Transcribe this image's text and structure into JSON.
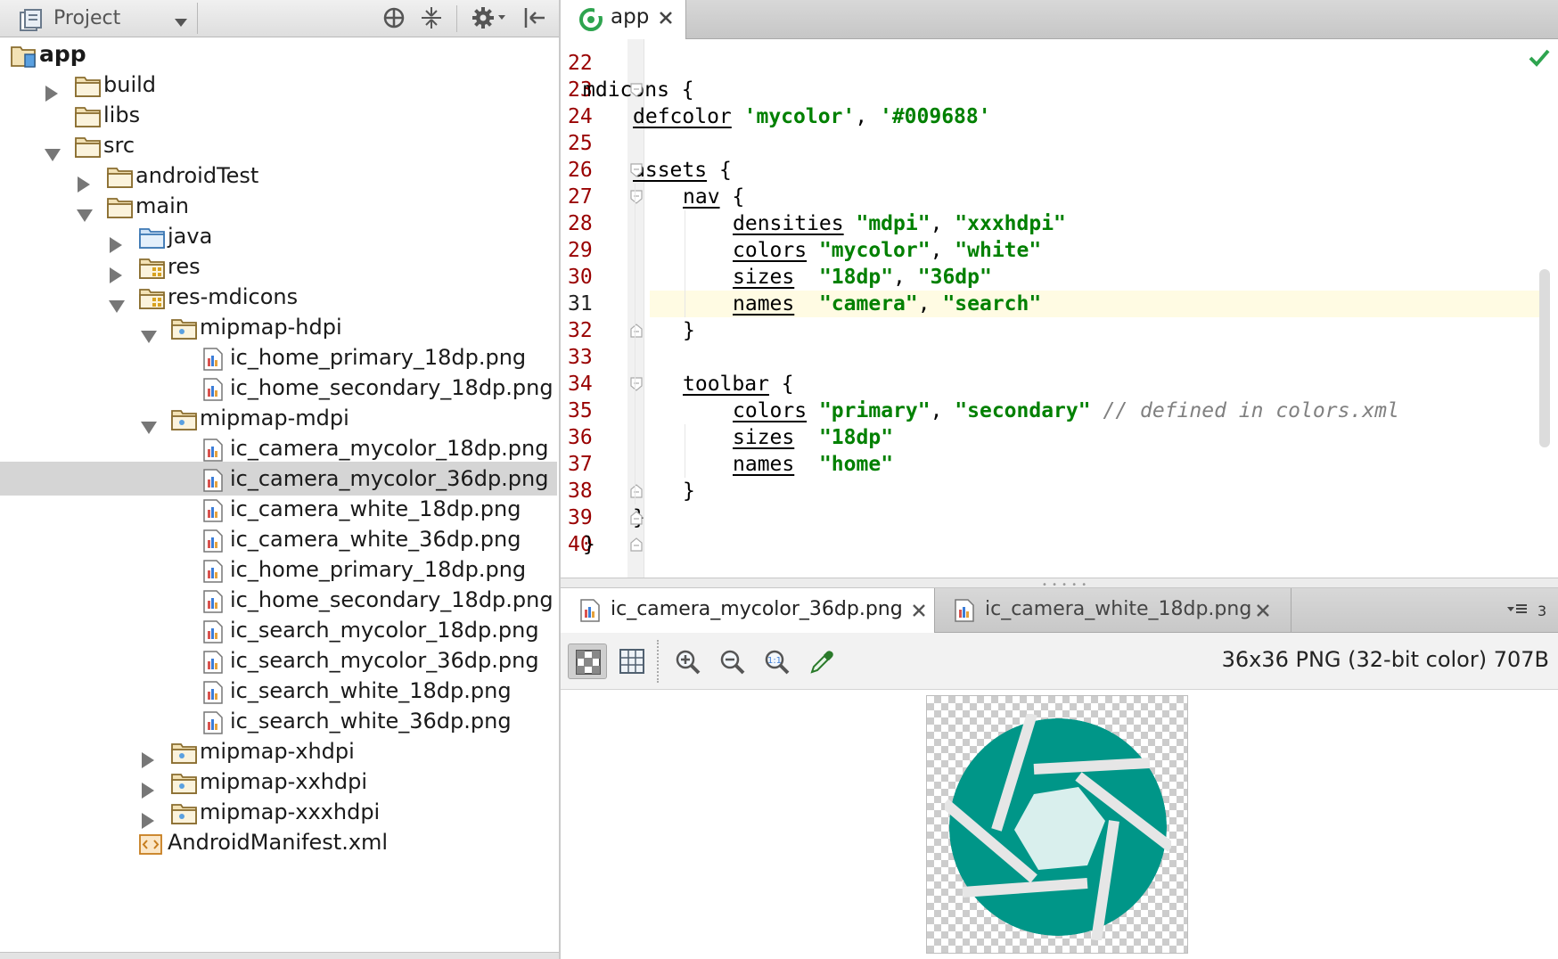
{
  "colors": {
    "accent_teal": "#009688",
    "string_green": "#008000",
    "line_number_red": "#990000",
    "comment_gray": "#808080"
  },
  "project_panel": {
    "title": "Project",
    "toolbar_icons": [
      "crosshair-icon",
      "collapse-icon",
      "gear-icon",
      "hide-panel-icon"
    ],
    "tree": [
      {
        "label": "app",
        "depth": 0,
        "expanded": null,
        "icon": "module-folder-icon",
        "bold": true
      },
      {
        "label": "build",
        "depth": 1,
        "expanded": false,
        "icon": "folder-icon"
      },
      {
        "label": "libs",
        "depth": 1,
        "expanded": null,
        "icon": "folder-icon"
      },
      {
        "label": "src",
        "depth": 1,
        "expanded": true,
        "icon": "folder-icon"
      },
      {
        "label": "androidTest",
        "depth": 2,
        "expanded": false,
        "icon": "folder-icon"
      },
      {
        "label": "main",
        "depth": 2,
        "expanded": true,
        "icon": "folder-icon"
      },
      {
        "label": "java",
        "depth": 3,
        "expanded": false,
        "icon": "source-folder-icon"
      },
      {
        "label": "res",
        "depth": 3,
        "expanded": false,
        "icon": "resource-folder-icon"
      },
      {
        "label": "res-mdicons",
        "depth": 3,
        "expanded": true,
        "icon": "resource-folder-icon"
      },
      {
        "label": "mipmap-hdpi",
        "depth": 4,
        "expanded": true,
        "icon": "package-folder-icon"
      },
      {
        "label": "ic_home_primary_18dp.png",
        "depth": 5,
        "expanded": null,
        "icon": "image-file-icon"
      },
      {
        "label": "ic_home_secondary_18dp.png",
        "depth": 5,
        "expanded": null,
        "icon": "image-file-icon"
      },
      {
        "label": "mipmap-mdpi",
        "depth": 4,
        "expanded": true,
        "icon": "package-folder-icon"
      },
      {
        "label": "ic_camera_mycolor_18dp.png",
        "depth": 5,
        "expanded": null,
        "icon": "image-file-icon"
      },
      {
        "label": "ic_camera_mycolor_36dp.png",
        "depth": 5,
        "expanded": null,
        "icon": "image-file-icon",
        "selected": true
      },
      {
        "label": "ic_camera_white_18dp.png",
        "depth": 5,
        "expanded": null,
        "icon": "image-file-icon"
      },
      {
        "label": "ic_camera_white_36dp.png",
        "depth": 5,
        "expanded": null,
        "icon": "image-file-icon"
      },
      {
        "label": "ic_home_primary_18dp.png",
        "depth": 5,
        "expanded": null,
        "icon": "image-file-icon"
      },
      {
        "label": "ic_home_secondary_18dp.png",
        "depth": 5,
        "expanded": null,
        "icon": "image-file-icon"
      },
      {
        "label": "ic_search_mycolor_18dp.png",
        "depth": 5,
        "expanded": null,
        "icon": "image-file-icon"
      },
      {
        "label": "ic_search_mycolor_36dp.png",
        "depth": 5,
        "expanded": null,
        "icon": "image-file-icon"
      },
      {
        "label": "ic_search_white_18dp.png",
        "depth": 5,
        "expanded": null,
        "icon": "image-file-icon"
      },
      {
        "label": "ic_search_white_36dp.png",
        "depth": 5,
        "expanded": null,
        "icon": "image-file-icon"
      },
      {
        "label": "mipmap-xhdpi",
        "depth": 4,
        "expanded": false,
        "icon": "package-folder-icon"
      },
      {
        "label": "mipmap-xxhdpi",
        "depth": 4,
        "expanded": false,
        "icon": "package-folder-icon"
      },
      {
        "label": "mipmap-xxxhdpi",
        "depth": 4,
        "expanded": false,
        "icon": "package-folder-icon"
      },
      {
        "label": "AndroidManifest.xml",
        "depth": 3,
        "expanded": null,
        "icon": "xml-file-icon"
      }
    ]
  },
  "editor": {
    "tab_label": "app",
    "current_line": "31",
    "lines": [
      {
        "num": "22",
        "indent": 0,
        "tokens": []
      },
      {
        "num": "23",
        "indent": 0,
        "tokens": [
          {
            "t": "plain",
            "v": "mdicons {"
          }
        ]
      },
      {
        "num": "24",
        "indent": 1,
        "tokens": [
          {
            "t": "kw",
            "v": "defcolor"
          },
          {
            "t": "plain",
            "v": " "
          },
          {
            "t": "str",
            "v": "'mycolor'"
          },
          {
            "t": "plain",
            "v": ", "
          },
          {
            "t": "str",
            "v": "'#009688'"
          }
        ]
      },
      {
        "num": "25",
        "indent": 0,
        "tokens": []
      },
      {
        "num": "26",
        "indent": 1,
        "tokens": [
          {
            "t": "kw",
            "v": "assets"
          },
          {
            "t": "plain",
            "v": " {"
          }
        ]
      },
      {
        "num": "27",
        "indent": 2,
        "tokens": [
          {
            "t": "kw",
            "v": "nav"
          },
          {
            "t": "plain",
            "v": " {"
          }
        ]
      },
      {
        "num": "28",
        "indent": 3,
        "tokens": [
          {
            "t": "kw",
            "v": "densities"
          },
          {
            "t": "plain",
            "v": " "
          },
          {
            "t": "str",
            "v": "\"mdpi\""
          },
          {
            "t": "plain",
            "v": ", "
          },
          {
            "t": "str",
            "v": "\"xxxhdpi\""
          }
        ]
      },
      {
        "num": "29",
        "indent": 3,
        "tokens": [
          {
            "t": "kw",
            "v": "colors"
          },
          {
            "t": "plain",
            "v": " "
          },
          {
            "t": "str",
            "v": "\"mycolor\""
          },
          {
            "t": "plain",
            "v": ", "
          },
          {
            "t": "str",
            "v": "\"white\""
          }
        ]
      },
      {
        "num": "30",
        "indent": 3,
        "tokens": [
          {
            "t": "kw",
            "v": "sizes"
          },
          {
            "t": "plain",
            "v": "  "
          },
          {
            "t": "str",
            "v": "\"18dp\""
          },
          {
            "t": "plain",
            "v": ", "
          },
          {
            "t": "str",
            "v": "\"36dp\""
          }
        ]
      },
      {
        "num": "31",
        "indent": 3,
        "tokens": [
          {
            "t": "kw",
            "v": "names"
          },
          {
            "t": "plain",
            "v": "  "
          },
          {
            "t": "str",
            "v": "\"camera\""
          },
          {
            "t": "plain",
            "v": ", "
          },
          {
            "t": "str",
            "v": "\"search\""
          }
        ]
      },
      {
        "num": "32",
        "indent": 2,
        "tokens": [
          {
            "t": "plain",
            "v": "}"
          }
        ]
      },
      {
        "num": "33",
        "indent": 0,
        "tokens": []
      },
      {
        "num": "34",
        "indent": 2,
        "tokens": [
          {
            "t": "kw",
            "v": "toolbar"
          },
          {
            "t": "plain",
            "v": " {"
          }
        ]
      },
      {
        "num": "35",
        "indent": 3,
        "tokens": [
          {
            "t": "kw",
            "v": "colors"
          },
          {
            "t": "plain",
            "v": " "
          },
          {
            "t": "str",
            "v": "\"primary\""
          },
          {
            "t": "plain",
            "v": ", "
          },
          {
            "t": "str",
            "v": "\"secondary\""
          },
          {
            "t": "plain",
            "v": " "
          },
          {
            "t": "cmt",
            "v": "// defined in colors.xml"
          }
        ]
      },
      {
        "num": "36",
        "indent": 3,
        "tokens": [
          {
            "t": "kw",
            "v": "sizes"
          },
          {
            "t": "plain",
            "v": "  "
          },
          {
            "t": "str",
            "v": "\"18dp\""
          }
        ]
      },
      {
        "num": "37",
        "indent": 3,
        "tokens": [
          {
            "t": "kw",
            "v": "names"
          },
          {
            "t": "plain",
            "v": "  "
          },
          {
            "t": "str",
            "v": "\"home\""
          }
        ]
      },
      {
        "num": "38",
        "indent": 2,
        "tokens": [
          {
            "t": "plain",
            "v": "}"
          }
        ]
      },
      {
        "num": "39",
        "indent": 1,
        "tokens": [
          {
            "t": "plain",
            "v": "}"
          }
        ]
      },
      {
        "num": "40",
        "indent": 0,
        "tokens": [
          {
            "t": "plain",
            "v": "}"
          }
        ]
      }
    ]
  },
  "image_viewer": {
    "tabs": [
      {
        "label": "ic_camera_mycolor_36dp.png",
        "active": true
      },
      {
        "label": "ic_camera_white_18dp.png",
        "active": false
      }
    ],
    "hidden_tabs_count": "3",
    "toolbar_icons": [
      "chessboard-icon",
      "grid-icon",
      "zoom-in-icon",
      "zoom-out-icon",
      "actual-size-icon",
      "color-picker-icon"
    ],
    "image_info": "36x36 PNG (32-bit color) 707B",
    "preview_icon": "camera-iris-icon"
  }
}
